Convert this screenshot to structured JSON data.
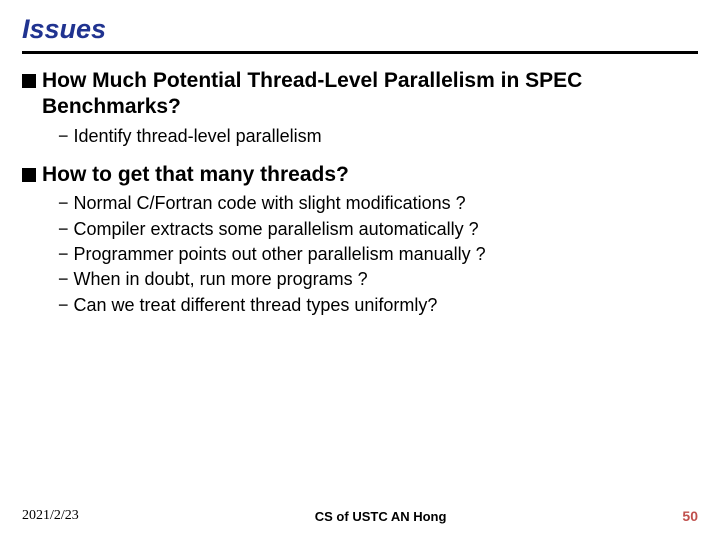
{
  "title": "Issues",
  "bullets": [
    {
      "text": "How Much Potential Thread-Level Parallelism in SPEC Benchmarks?",
      "sub": [
        "Identify thread-level parallelism"
      ]
    },
    {
      "text": "How to get that many threads?",
      "sub": [
        "Normal C/Fortran code with slight modifications ?",
        "Compiler extracts some parallelism automatically ?",
        "Programmer points out other parallelism manually ?",
        "When in doubt, run more programs ?",
        "Can we treat different thread types uniformly?"
      ]
    }
  ],
  "footer": {
    "date": "2021/2/23",
    "course": "CS of USTC AN Hong",
    "page": "50"
  }
}
